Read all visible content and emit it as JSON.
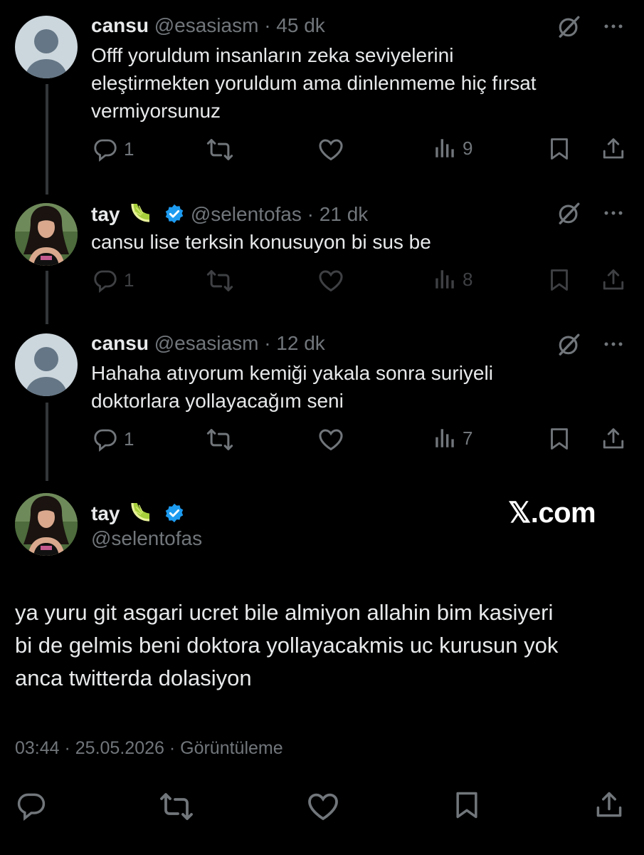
{
  "tweets": [
    {
      "name": "cansu",
      "handle": "@esasiasm",
      "sep": "·",
      "time": "45 dk",
      "text_lines": [
        "Offf yoruldum insanların zeka seviyelerini",
        "eleştirmekten yoruldum ama dinlenmeme hiç fırsat",
        "vermiyorsunuz"
      ],
      "replies": "1",
      "views": "9"
    },
    {
      "name": "tay",
      "handle": "@selentofas",
      "sep": "·",
      "time": "21 dk",
      "text_lines": [
        "cansu lise terksin konusuyon bi sus be"
      ],
      "replies": "1",
      "views": "8"
    },
    {
      "name": "cansu",
      "handle": "@esasiasm",
      "sep": "·",
      "time": "12 dk",
      "text_lines": [
        "Hahaha atıyorum kemiği yakala sonra suriyeli",
        "doktorlara yollayacağım seni"
      ],
      "replies": "1",
      "views": "7"
    }
  ],
  "main_tweet": {
    "name": "tay",
    "handle": "@selentofas",
    "text_lines": [
      "ya yuru git asgari ucret bile almiyon allahin bim kasiyeri",
      "bi de gelmis beni doktora yollayacakmis uc kurusun yok",
      "anca twitterda dolasiyon"
    ],
    "meta": "03:44 · 25.05.2026 · Görüntüleme"
  },
  "watermark": "𝕏.com",
  "icons": [
    "reply-icon",
    "retweet-icon",
    "like-icon",
    "views-icon",
    "bookmark-icon",
    "share-icon",
    "grok-icon",
    "more-icon",
    "verified-badge-icon",
    "lime-emoji"
  ],
  "colors": {
    "background": "#000000",
    "text": "#e7e9ea",
    "muted": "#71767b",
    "verified": "#1d9bf0",
    "thread_line": "#333639"
  }
}
